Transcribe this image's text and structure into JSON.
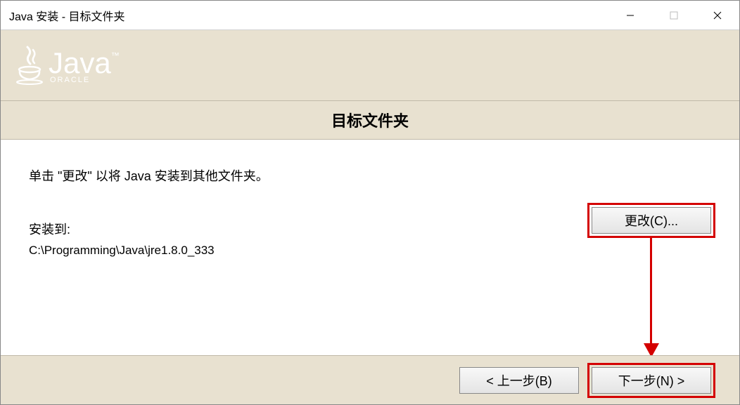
{
  "titlebar": {
    "title": "Java 安装 - 目标文件夹"
  },
  "header": {
    "logo_text": "Java",
    "logo_tm": "™",
    "logo_sub": "ORACLE"
  },
  "subtitle": "目标文件夹",
  "content": {
    "instruction": "单击 \"更改\" 以将 Java 安装到其他文件夹。",
    "install_label": "安装到:",
    "install_path": "C:\\Programming\\Java\\jre1.8.0_333",
    "change_button": "更改(C)..."
  },
  "footer": {
    "back_button": "< 上一步(B)",
    "next_button": "下一步(N) >"
  }
}
